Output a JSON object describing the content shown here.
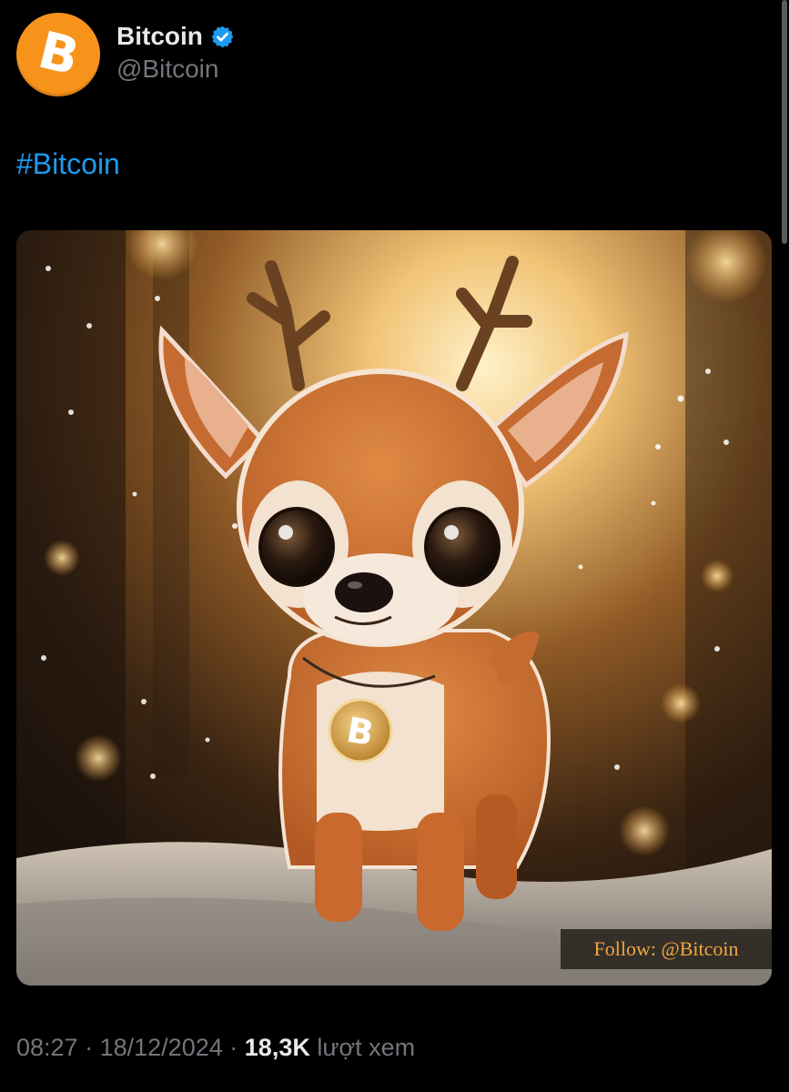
{
  "author": {
    "display_name": "Bitcoin",
    "handle": "@Bitcoin",
    "avatar_symbol": "B",
    "avatar_color": "#f7931a",
    "verified_color": "#1d9bf0",
    "verified_icon": "verified-badge-icon"
  },
  "tweet": {
    "text": "#Bitcoin",
    "link_color": "#1d9bf0"
  },
  "media": {
    "watermark": "Follow: @Bitcoin",
    "pendant_symbol": "B"
  },
  "meta": {
    "time": "08:27",
    "separator": "·",
    "date": "18/12/2024",
    "views_count": "18,3K",
    "views_label": "lượt xem"
  }
}
